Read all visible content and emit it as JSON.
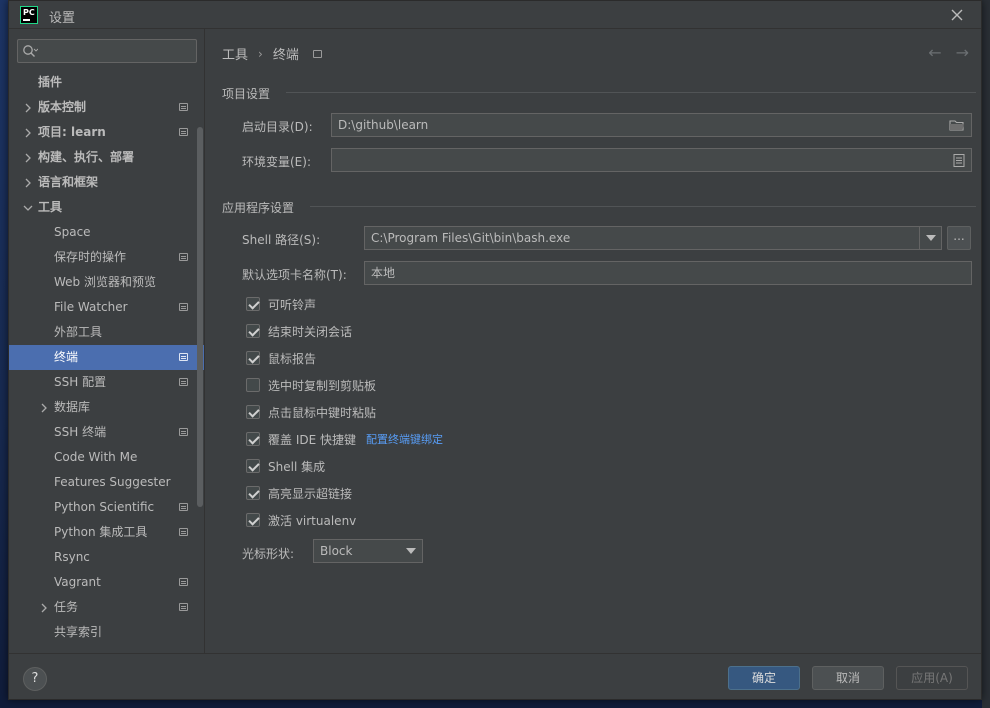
{
  "window": {
    "title": "设置",
    "app_icon_text": "PC"
  },
  "search": {
    "placeholder": "",
    "value": ""
  },
  "sidebar": {
    "items": [
      {
        "label": "插件",
        "level": 1,
        "arrow": "",
        "badge": false,
        "bold": true,
        "selected": false
      },
      {
        "label": "版本控制",
        "level": 0,
        "arrow": "right",
        "badge": true,
        "bold": true,
        "selected": false
      },
      {
        "label": "项目: learn",
        "level": 0,
        "arrow": "right",
        "badge": true,
        "bold": true,
        "selected": false
      },
      {
        "label": "构建、执行、部署",
        "level": 0,
        "arrow": "right",
        "badge": false,
        "bold": true,
        "selected": false
      },
      {
        "label": "语言和框架",
        "level": 0,
        "arrow": "right",
        "badge": false,
        "bold": true,
        "selected": false
      },
      {
        "label": "工具",
        "level": 0,
        "arrow": "down",
        "badge": false,
        "bold": true,
        "selected": false
      },
      {
        "label": "Space",
        "level": 2,
        "arrow": "",
        "badge": false,
        "bold": false,
        "selected": false
      },
      {
        "label": "保存时的操作",
        "level": 2,
        "arrow": "",
        "badge": true,
        "bold": false,
        "selected": false
      },
      {
        "label": "Web 浏览器和预览",
        "level": 2,
        "arrow": "",
        "badge": false,
        "bold": false,
        "selected": false
      },
      {
        "label": "File Watcher",
        "level": 2,
        "arrow": "",
        "badge": true,
        "bold": false,
        "selected": false
      },
      {
        "label": "外部工具",
        "level": 2,
        "arrow": "",
        "badge": false,
        "bold": false,
        "selected": false
      },
      {
        "label": "终端",
        "level": 2,
        "arrow": "",
        "badge": true,
        "bold": false,
        "selected": true
      },
      {
        "label": "SSH 配置",
        "level": 2,
        "arrow": "",
        "badge": true,
        "bold": false,
        "selected": false
      },
      {
        "label": "数据库",
        "level": 1,
        "arrow": "right",
        "badge": false,
        "bold": false,
        "selected": false
      },
      {
        "label": "SSH 终端",
        "level": 2,
        "arrow": "",
        "badge": true,
        "bold": false,
        "selected": false
      },
      {
        "label": "Code With Me",
        "level": 2,
        "arrow": "",
        "badge": false,
        "bold": false,
        "selected": false
      },
      {
        "label": "Features Suggester",
        "level": 2,
        "arrow": "",
        "badge": false,
        "bold": false,
        "selected": false
      },
      {
        "label": "Python Scientific",
        "level": 2,
        "arrow": "",
        "badge": true,
        "bold": false,
        "selected": false
      },
      {
        "label": "Python 集成工具",
        "level": 2,
        "arrow": "",
        "badge": true,
        "bold": false,
        "selected": false
      },
      {
        "label": "Rsync",
        "level": 2,
        "arrow": "",
        "badge": false,
        "bold": false,
        "selected": false
      },
      {
        "label": "Vagrant",
        "level": 2,
        "arrow": "",
        "badge": true,
        "bold": false,
        "selected": false
      },
      {
        "label": "任务",
        "level": 1,
        "arrow": "right",
        "badge": true,
        "bold": false,
        "selected": false
      },
      {
        "label": "共享索引",
        "level": 2,
        "arrow": "",
        "badge": false,
        "bold": false,
        "selected": false
      }
    ]
  },
  "breadcrumb": {
    "parent": "工具",
    "separator": "›",
    "current": "终端"
  },
  "nav": {
    "back": "←",
    "forward": "→"
  },
  "project_settings": {
    "title": "项目设置",
    "start_dir_label": "启动目录(D):",
    "start_dir_value": "D:\\github\\learn",
    "env_label": "环境变量(E):",
    "env_value": ""
  },
  "app_settings": {
    "title": "应用程序设置",
    "shell_label": "Shell 路径(S):",
    "shell_value": "C:\\Program Files\\Git\\bin\\bash.exe",
    "dots_label": "...",
    "tab_name_label": "默认选项卡名称(T):",
    "tab_name_value": "本地",
    "checkboxes": [
      {
        "label": "可听铃声",
        "checked": true
      },
      {
        "label": "结束时关闭会话",
        "checked": true
      },
      {
        "label": "鼠标报告",
        "checked": true
      },
      {
        "label": "选中时复制到剪贴板",
        "checked": false
      },
      {
        "label": "点击鼠标中键时粘贴",
        "checked": true
      },
      {
        "label": "覆盖 IDE 快捷键",
        "checked": true,
        "link": "配置终端键绑定"
      },
      {
        "label": "Shell 集成",
        "checked": true
      },
      {
        "label": "高亮显示超链接",
        "checked": true
      },
      {
        "label": "激活 virtualenv",
        "checked": true
      }
    ],
    "cursor_label": "光标形状:",
    "cursor_value": "Block"
  },
  "footer": {
    "help": "?",
    "ok": "确定",
    "cancel": "取消",
    "apply": "应用(A)"
  },
  "colors": {
    "selection": "#4b6eaf",
    "primary_button": "#365880",
    "link": "#589df6",
    "background": "#3c3f41"
  }
}
